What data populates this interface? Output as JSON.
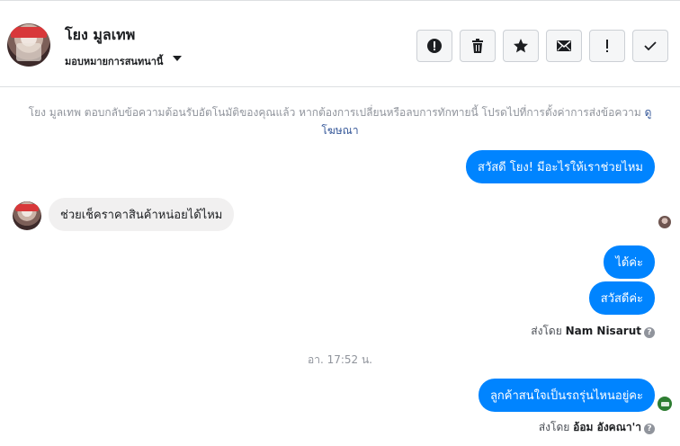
{
  "header": {
    "contact_name": "โยง มูลเทพ",
    "status_label": "มอบหมายการสนทนานี้"
  },
  "toolbar": {
    "buttons": [
      {
        "name": "report-spam",
        "icon": "alert-circle-icon"
      },
      {
        "name": "delete",
        "icon": "trash-icon"
      },
      {
        "name": "star",
        "icon": "star-icon"
      },
      {
        "name": "mark-unread",
        "icon": "envelope-icon"
      },
      {
        "name": "mark-follow-up",
        "icon": "exclamation-icon"
      },
      {
        "name": "mark-done",
        "icon": "checkmark-icon"
      }
    ]
  },
  "notice": {
    "text": "โยง มูลเทพ ตอบกลับข้อความต้อนรับอัตโนมัติของคุณแล้ว หากต้องการเปลี่ยนหรือลบการทักทายนี้ โปรดไปที่การตั้งค่าการส่งข้อความ",
    "link_text": "ดูโฆษณา"
  },
  "messages": [
    {
      "direction": "out",
      "text": "สวัสดี โยง! มีอะไรให้เราช่วยไหม"
    },
    {
      "direction": "in",
      "text": "ช่วยเช็คราคาสินค้าหน่อยได้ไหม"
    },
    {
      "direction": "out",
      "text": "ได้ค่ะ"
    },
    {
      "direction": "out",
      "text": "สวัสดีค่ะ"
    },
    {
      "direction": "out",
      "text": "ลูกค้าสนใจเป็นรถรุ่นไหนอยู่คะ"
    }
  ],
  "sent_by_1": {
    "prefix": "ส่งโดย",
    "name": "Nam Nisarut"
  },
  "timestamp": "อา. 17:52 น.",
  "sent_by_2": {
    "prefix": "ส่งโดย",
    "name": "อ้อม อังคณา'า"
  },
  "colors": {
    "outgoing_bubble": "#0084ff",
    "incoming_bubble": "#f1f0f0",
    "link": "#365899",
    "muted_text": "#90949c"
  }
}
